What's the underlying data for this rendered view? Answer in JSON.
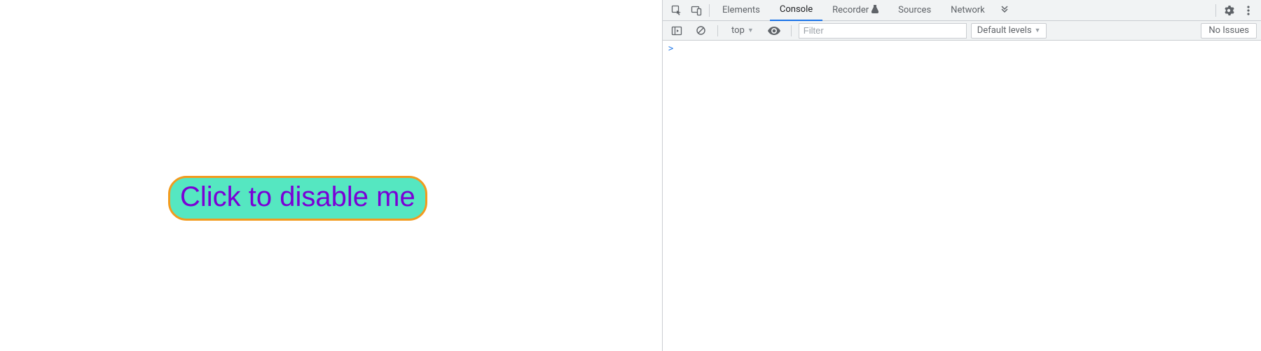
{
  "page": {
    "button_label": "Click to disable me"
  },
  "devtools": {
    "tabs": {
      "elements": "Elements",
      "console": "Console",
      "recorder": "Recorder",
      "sources": "Sources",
      "network": "Network"
    },
    "active_tab": "console",
    "console_toolbar": {
      "execution_context": "top",
      "filter_placeholder": "Filter",
      "levels_label": "Default levels",
      "issues_label": "No Issues"
    },
    "console_prompt": ">"
  }
}
